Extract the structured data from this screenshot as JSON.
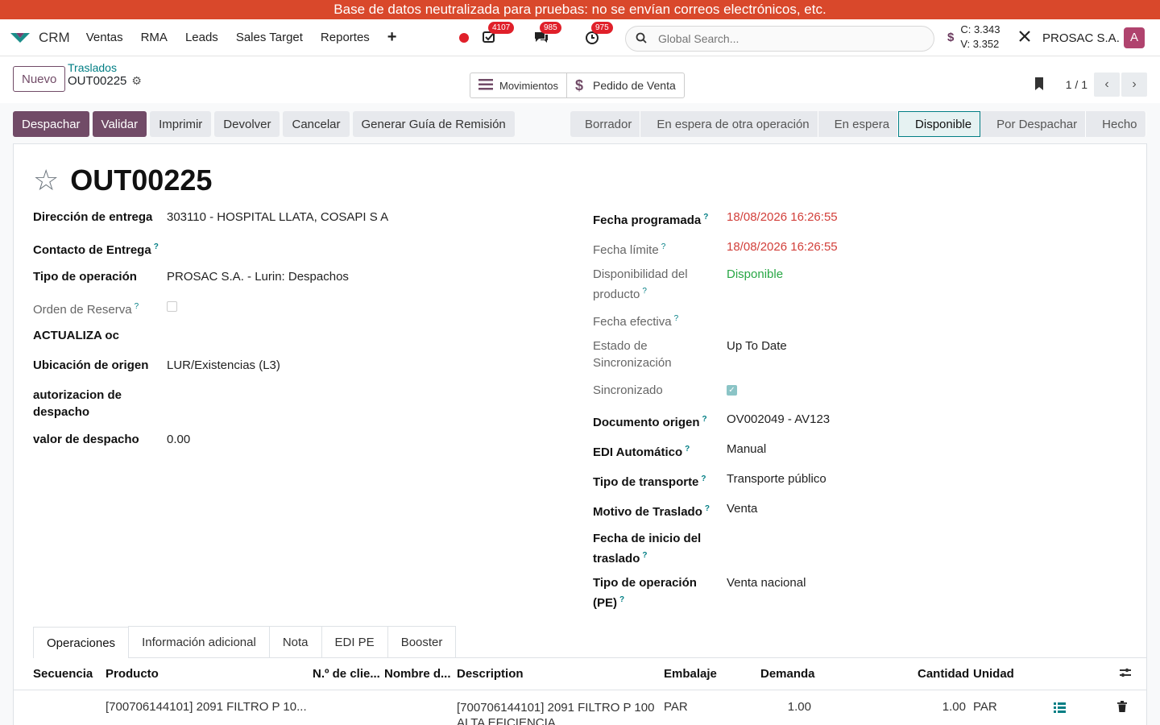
{
  "banner": "Base de datos neutralizada para pruebas: no se envían correos electrónicos, etc.",
  "nav": {
    "app": "CRM",
    "menus": [
      "Ventas",
      "RMA",
      "Leads",
      "Sales Target",
      "Reportes"
    ],
    "activities_count": "4107",
    "messages_count": "985",
    "timer_count": "975",
    "search_placeholder": "Global Search...",
    "currency_c": "C: 3.343",
    "currency_v": "V: 3.352",
    "company": "PROSAC S.A.",
    "avatar_initial": "A"
  },
  "control": {
    "new_label": "Nuevo",
    "breadcrumb_parent": "Traslados",
    "breadcrumb_current": "OUT00225",
    "smart_moves": "Movimientos",
    "smart_sale": "Pedido de Venta",
    "pager": "1 / 1"
  },
  "actions": [
    "Despachar",
    "Validar",
    "Imprimir",
    "Devolver",
    "Cancelar",
    "Generar Guía de Remisión"
  ],
  "stages": [
    "Borrador",
    "En espera de otra operación",
    "En espera",
    "Disponible",
    "Por Despachar",
    "Hecho"
  ],
  "record": {
    "title": "OUT00225",
    "left": {
      "delivery_address_label": "Dirección de entrega",
      "delivery_address": "303110 - HOSPITAL LLATA, COSAPI S A",
      "contact_label": "Contacto de Entrega",
      "op_type_label": "Tipo de operación",
      "op_type": "PROSAC S.A. - Lurin: Despachos",
      "reserve_label": "Orden de Reserva",
      "update_label": "ACTUALIZA oc",
      "origin_loc_label": "Ubicación de origen",
      "origin_loc": "LUR/Existencias (L3)",
      "auth_label": "autorizacion de despacho",
      "dispatch_value_label": "valor de despacho",
      "dispatch_value": "0.00"
    },
    "right": {
      "scheduled_label": "Fecha programada",
      "scheduled": "18/08/2026 16:26:55",
      "deadline_label": "Fecha límite",
      "deadline": "18/08/2026 16:26:55",
      "availability_label": "Disponibilidad del producto",
      "availability": "Disponible",
      "effective_label": "Fecha efectiva",
      "sync_state_label": "Estado de Sincronización",
      "sync_state": "Up To Date",
      "synced_label": "Sincronizado",
      "origin_doc_label": "Documento origen",
      "origin_doc": "OV002049 - AV123",
      "edi_label": "EDI Automático",
      "edi": "Manual",
      "transport_label": "Tipo de transporte",
      "transport": "Transporte público",
      "reason_label": "Motivo de Traslado",
      "reason": "Venta",
      "start_label": "Fecha de inicio del traslado",
      "pe_op_label": "Tipo de operación (PE)",
      "pe_op": "Venta nacional"
    }
  },
  "tabs": [
    "Operaciones",
    "Información adicional",
    "Nota",
    "EDI PE",
    "Booster"
  ],
  "table": {
    "headers": [
      "Secuencia",
      "Producto",
      "N.º de clie...",
      "Nombre d...",
      "Description",
      "Embalaje",
      "Demanda",
      "Cantidad",
      "Unidad"
    ],
    "rows": [
      {
        "product": "[700706144101] 2091 FILTRO P 10...",
        "description": "[700706144101] 2091 FILTRO P 100 ALTA EFICIENCIA",
        "packaging": "PAR",
        "demand": "1.00",
        "quantity": "1.00",
        "unit": "PAR"
      }
    ]
  }
}
